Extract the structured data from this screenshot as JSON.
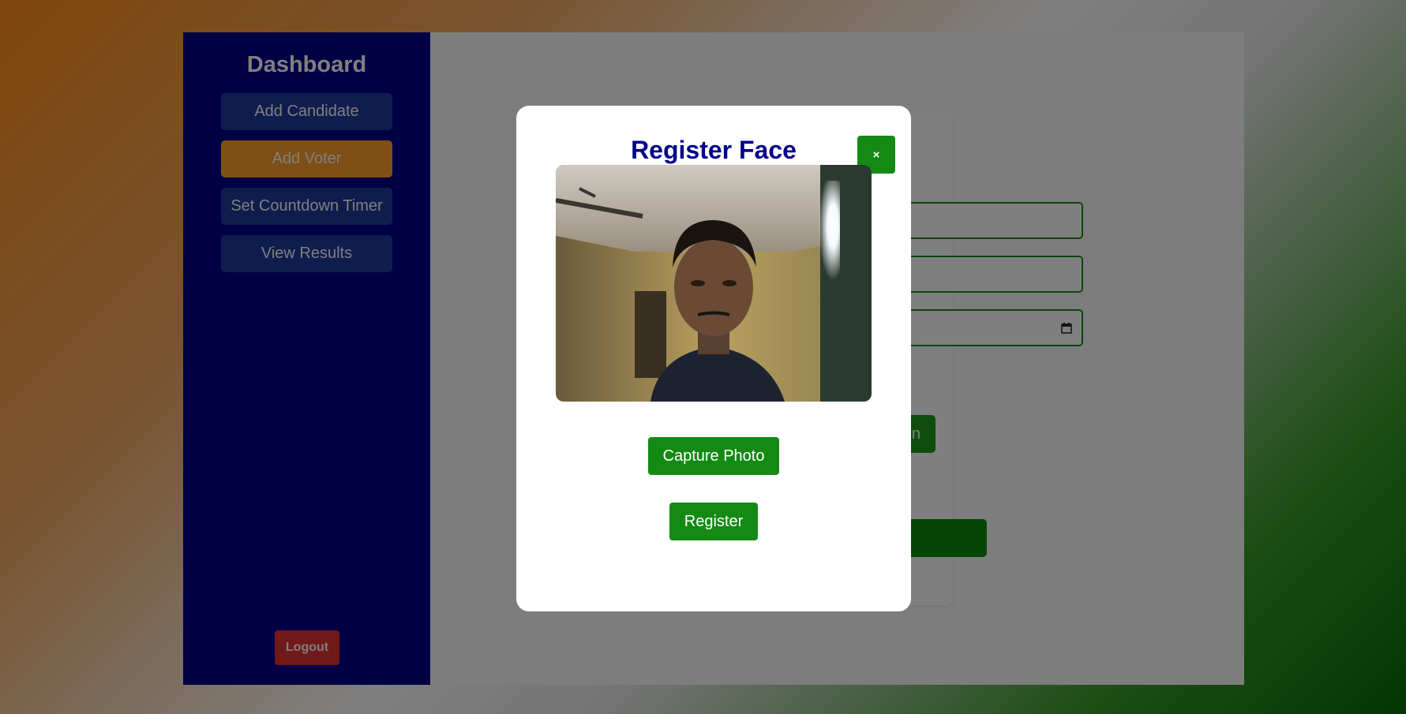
{
  "sidebar": {
    "title": "Dashboard",
    "items": [
      {
        "label": "Add Candidate"
      },
      {
        "label": "Add Voter"
      },
      {
        "label": "Set Countdown Timer"
      },
      {
        "label": "View Results"
      }
    ],
    "active_item": "Add Voter",
    "logout_label": "Logout"
  },
  "background_form": {
    "partial_button_text": "n"
  },
  "modal": {
    "title": "Register Face",
    "close_label": "×",
    "capture_label": "Capture Photo",
    "register_label": "Register"
  },
  "colors": {
    "sidebar": "#00008b",
    "nav_item": "#1f3a9c",
    "active_nav": "#ff9e2a",
    "logout": "#e23232",
    "button_green": "#148a14",
    "modal_title": "#00008b"
  },
  "icons": {
    "close": "close-icon",
    "calendar": "calendar-icon"
  }
}
